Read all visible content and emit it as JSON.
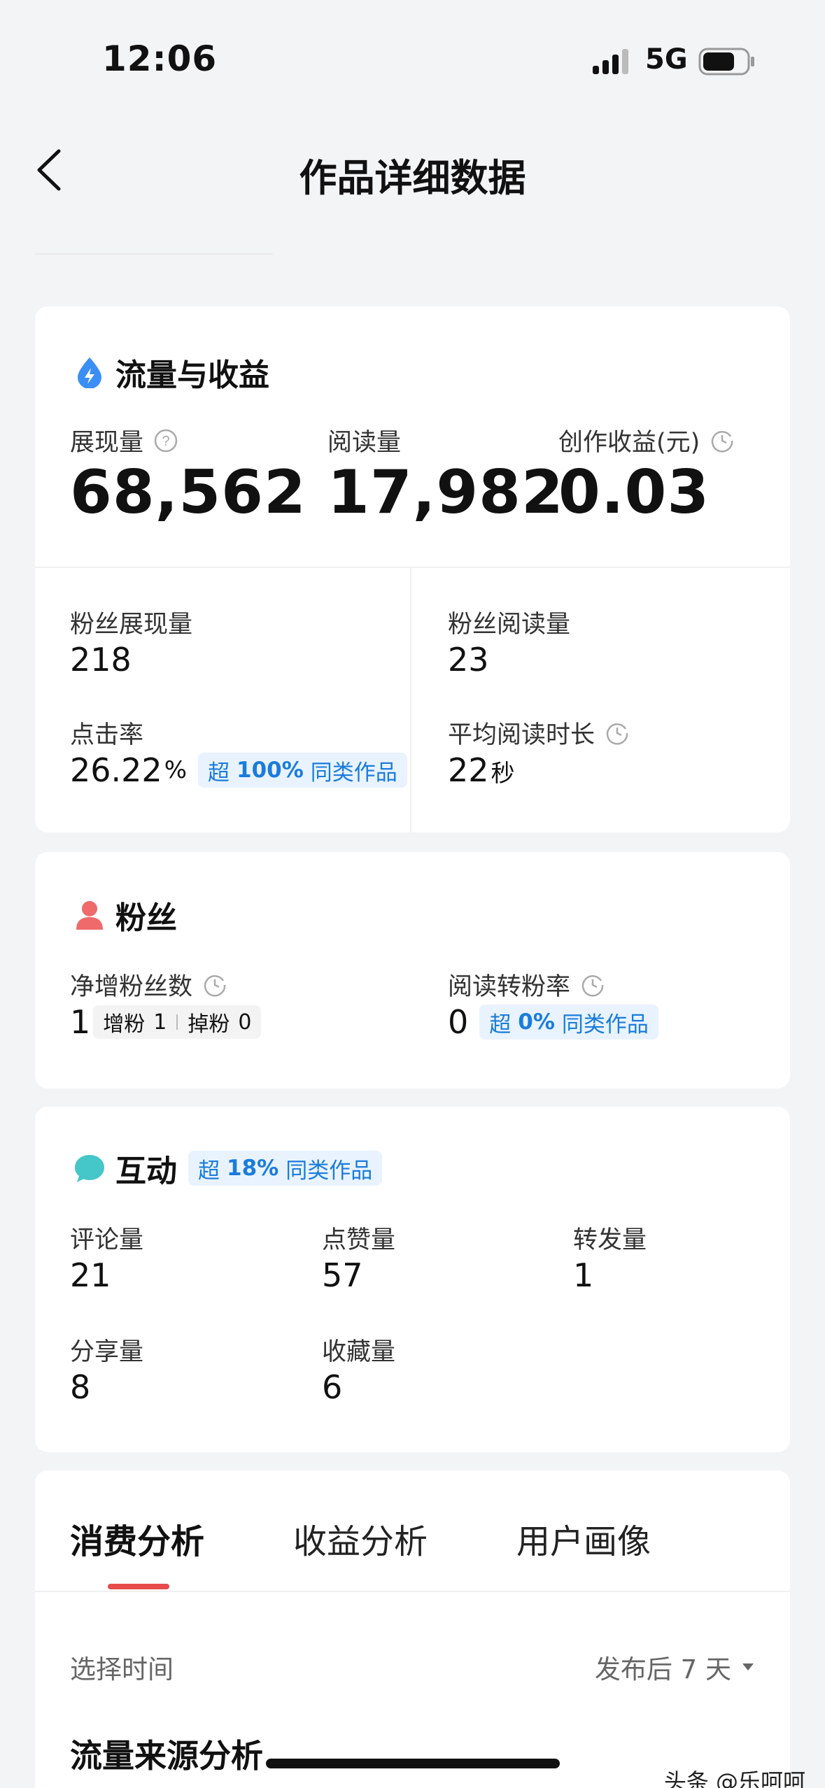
{
  "status_bar": {
    "time": "12:06",
    "network": "5G"
  },
  "nav": {
    "title": "作品详细数据"
  },
  "traffic": {
    "title": "流量与收益",
    "impressions": {
      "label": "展现量",
      "value": "68,562"
    },
    "reads": {
      "label": "阅读量",
      "value": "17,982"
    },
    "earnings": {
      "label": "创作收益(元)",
      "value": "0.03"
    },
    "fan_impressions": {
      "label": "粉丝展现量",
      "value": "218"
    },
    "fan_reads": {
      "label": "粉丝阅读量",
      "value": "23"
    },
    "ctr": {
      "label": "点击率",
      "value": "26.22",
      "unit": "%",
      "badge": {
        "prefix": "超",
        "value": "100%",
        "suffix": "同类作品"
      }
    },
    "avg_read_time": {
      "label": "平均阅读时长",
      "value": "22",
      "unit": "秒"
    }
  },
  "fans": {
    "title": "粉丝",
    "net_gain": {
      "label": "净增粉丝数",
      "value": "1",
      "gained_label": "增粉",
      "gained": "1",
      "lost_label": "掉粉",
      "lost": "0"
    },
    "conversion": {
      "label": "阅读转粉率",
      "value": "0",
      "badge": {
        "prefix": "超",
        "value": "0%",
        "suffix": "同类作品"
      }
    }
  },
  "interaction": {
    "title": "互动",
    "badge": {
      "prefix": "超",
      "value": "18%",
      "suffix": "同类作品"
    },
    "comments": {
      "label": "评论量",
      "value": "21"
    },
    "likes": {
      "label": "点赞量",
      "value": "57"
    },
    "reposts": {
      "label": "转发量",
      "value": "1"
    },
    "shares": {
      "label": "分享量",
      "value": "8"
    },
    "favorites": {
      "label": "收藏量",
      "value": "6"
    }
  },
  "analysis": {
    "tabs": [
      "消费分析",
      "收益分析",
      "用户画像"
    ],
    "active_tab": 0,
    "time_label": "选择时间",
    "time_value": "发布后 7 天",
    "section_title": "流量来源分析"
  },
  "watermark": "头条 @乐呵呵",
  "colors": {
    "accent_blue": "#1a7cdb",
    "tab_indicator": "#e84b4b",
    "badge_bg": "#e9f3ff"
  }
}
